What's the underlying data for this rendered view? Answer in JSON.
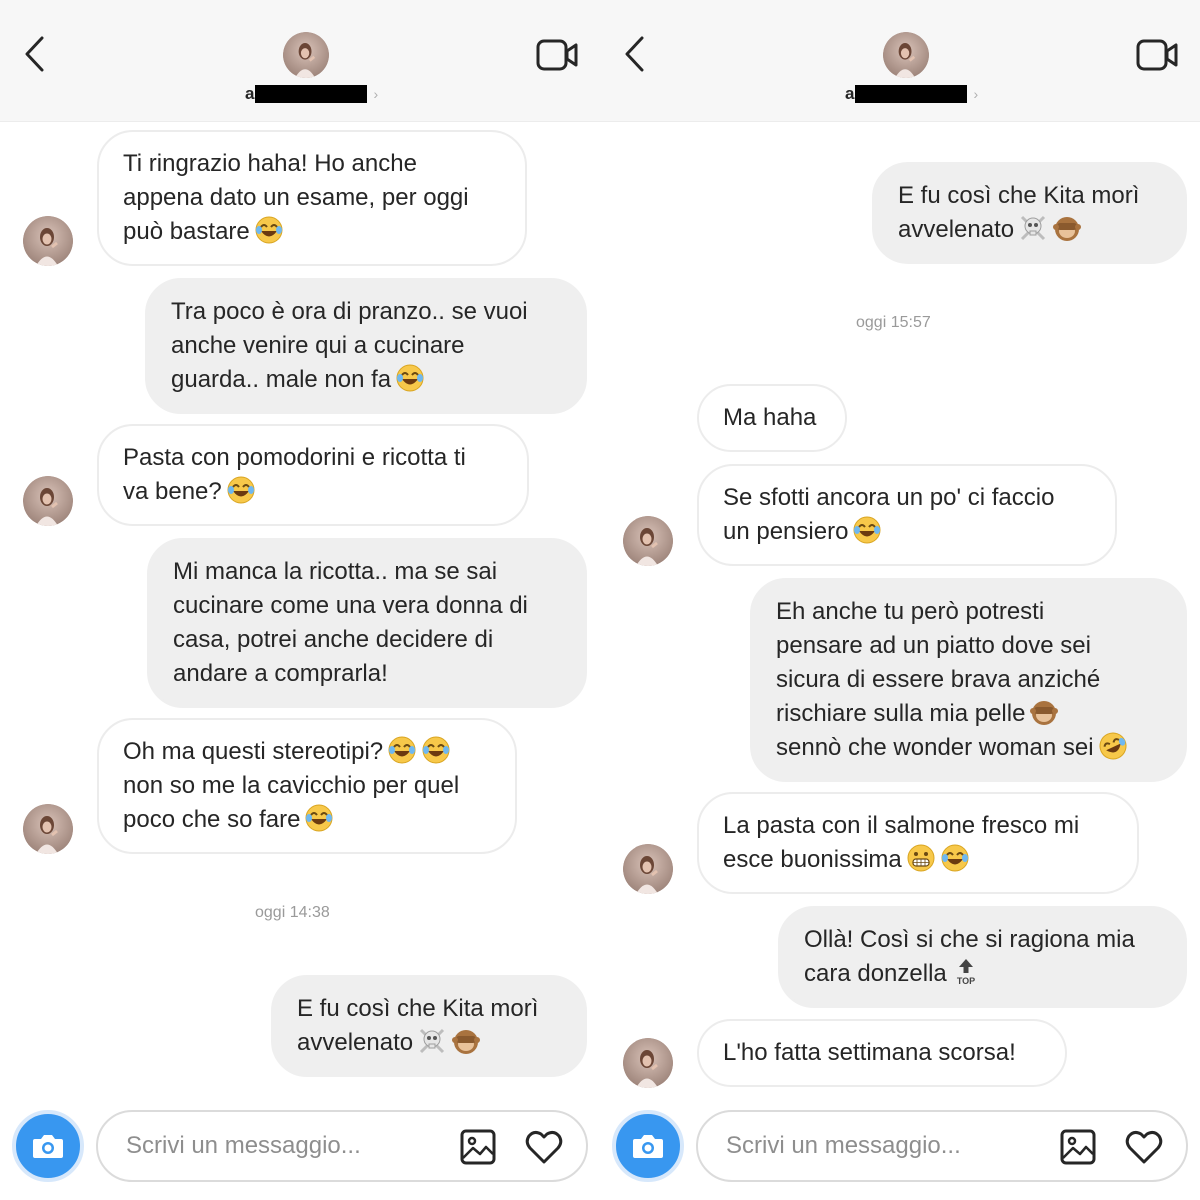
{
  "left": {
    "header": {
      "handle_initial": "a"
    },
    "messages": [
      {
        "lines": [
          "Ti ringrazio haha! Ho anche",
          "appena dato un esame, per oggi",
          "può bastare"
        ],
        "emoji": [
          "face-with-tears-of-joy"
        ]
      },
      {
        "lines": [
          "Tra poco è ora di pranzo.. se vuoi",
          "anche venire qui a cucinare",
          "guarda.. male non fa"
        ],
        "emoji": [
          "face-with-tears-of-joy"
        ]
      },
      {
        "lines": [
          "Pasta con pomodorini e ricotta ti",
          "va bene?"
        ],
        "emoji": [
          "face-with-tears-of-joy"
        ]
      },
      {
        "lines": [
          "Mi manca la ricotta.. ma se sai",
          "cucinare come una vera donna di",
          "casa, potrei anche decidere di",
          "andare a comprarla!"
        ],
        "emoji": []
      },
      {
        "lines": [
          "Oh ma questi stereotipi?",
          "non so me la cavicchio per quel",
          "poco che so fare"
        ],
        "emoji": [
          "face-with-tears-of-joy",
          "face-with-tears-of-joy"
        ]
      },
      {
        "lines": [
          "E fu così che Kita morì",
          "avvelenato"
        ],
        "emoji": [
          "skull-and-crossbones",
          "see-no-evil-monkey"
        ]
      }
    ],
    "timestamp": "oggi 14:38",
    "composer": {
      "placeholder": "Scrivi un messaggio..."
    }
  },
  "right": {
    "header": {
      "handle_initial": "a"
    },
    "messages": [
      {
        "lines": [
          "E fu così che Kita morì",
          "avvelenato"
        ],
        "emoji": [
          "skull-and-crossbones",
          "see-no-evil-monkey"
        ]
      },
      {
        "lines": [
          "Ma haha"
        ],
        "emoji": []
      },
      {
        "lines": [
          "Se sfotti ancora un po' ci faccio",
          "un pensiero"
        ],
        "emoji": [
          "face-with-tears-of-joy"
        ]
      },
      {
        "lines": [
          "Eh anche tu però potresti",
          "pensare ad un piatto dove sei",
          "sicura di essere brava anziché",
          "rischiare sulla mia pelle",
          "sennò che wonder woman sei"
        ],
        "emoji": [
          "see-no-evil-monkey",
          "rolling-on-floor-laughing"
        ]
      },
      {
        "lines": [
          "La pasta con il salmone fresco mi",
          "esce buonissima"
        ],
        "emoji": [
          "grimacing-face",
          "face-with-tears-of-joy"
        ]
      },
      {
        "lines": [
          "Ollà! Così si che si ragiona mia",
          "cara donzella"
        ],
        "emoji": [
          "top-arrow"
        ]
      },
      {
        "lines": [
          "L'ho fatta settimana scorsa!"
        ],
        "emoji": []
      }
    ],
    "timestamp": "oggi 15:57",
    "composer": {
      "placeholder": "Scrivi un messaggio..."
    }
  },
  "colors": {
    "accent": "#3897f0",
    "outgoing_bubble": "#efefef",
    "incoming_border": "#ececec",
    "header_bg": "#f7f7f7"
  },
  "icons": [
    "back-chevron-icon",
    "video-call-icon",
    "camera-icon",
    "gallery-icon",
    "heart-icon"
  ]
}
